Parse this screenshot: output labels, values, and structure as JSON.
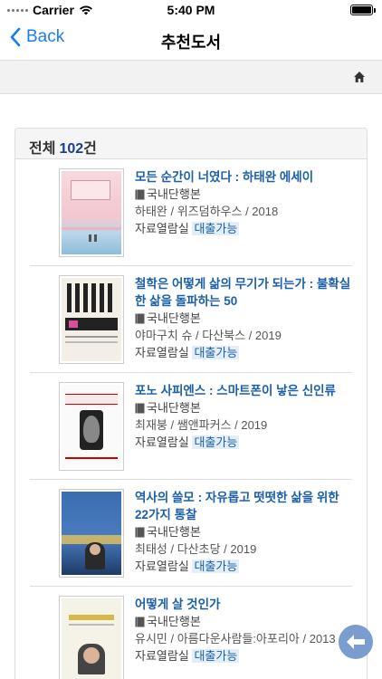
{
  "status_bar": {
    "carrier": "Carrier",
    "time": "5:40 PM"
  },
  "nav": {
    "back_label": "Back",
    "title": "추천도서"
  },
  "panel": {
    "total_prefix": "전체",
    "total_count": "102",
    "total_suffix": "건"
  },
  "books": [
    {
      "title": "모든 순간이 너였다 : 하태완 에세이",
      "type": "국내단행본",
      "meta": "하태완 / 위즈덤하우스 / 2018",
      "location": "자료열람실",
      "status": "대출가능"
    },
    {
      "title": "철학은 어떻게 삶의 무기가 되는가 : 불확실한 삶을 돌파하는 50",
      "type": "국내단행본",
      "meta": "야마구치 슈 / 다산북스 / 2019",
      "location": "자료열람실",
      "status": "대출가능"
    },
    {
      "title": "포노 사피엔스 : 스마트폰이 낳은 신인류",
      "type": "국내단행본",
      "meta": "최재붕 / 쌤앤파커스 / 2019",
      "location": "자료열람실",
      "status": "대출가능"
    },
    {
      "title": "역사의 쓸모 : 자유롭고 떳떳한 삶을 위한 22가지 통찰",
      "type": "국내단행본",
      "meta": "최태성 / 다산초당 / 2019",
      "location": "자료열람실",
      "status": "대출가능"
    },
    {
      "title": "어떻게 살 것인가",
      "type": "국내단행본",
      "meta": "유시민 / 아름다운사람들:아포리아 / 2013",
      "location": "자료열람실",
      "status": "대출가능"
    }
  ],
  "covers": [
    {
      "cover_text": "모든 순간이 너였다"
    },
    {
      "cover_text": "삶의 무기가 되는가"
    },
    {
      "cover_text": "포노 사피엔스"
    },
    {
      "cover_text": "역사의 쓸모"
    },
    {
      "cover_text": "어떻게 살 것인가"
    }
  ],
  "colors": {
    "accent": "#1a5fa8",
    "ios_blue": "#1a7cf4",
    "fab": "#7a9ccf"
  },
  "icons": {
    "back": "chevron-left-icon",
    "home": "home-icon",
    "book_type": "book-icon",
    "fab": "arrow-left-icon"
  }
}
